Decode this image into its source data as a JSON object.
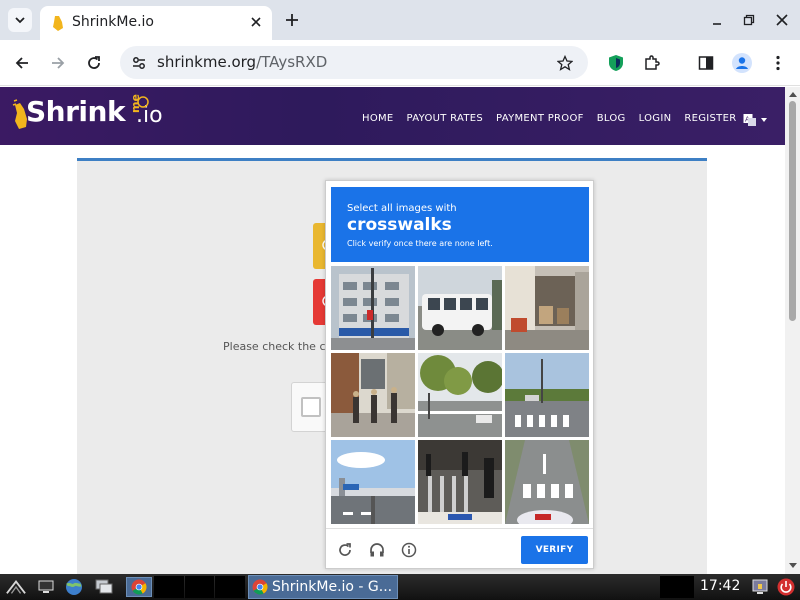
{
  "browser": {
    "tab_title": "ShrinkMe.io",
    "url_domain": "shrinkme.org",
    "url_path": "/TAysRXD"
  },
  "site": {
    "logo_text": "Shrink",
    "logo_me": "me",
    "logo_suffix": ".io",
    "nav": [
      "HOME",
      "PAYOUT RATES",
      "PAYMENT PROOF",
      "BLOG",
      "LOGIN",
      "REGISTER"
    ],
    "check_text": "Please check the ca"
  },
  "captcha": {
    "line1": "Select all images with",
    "target": "crosswalks",
    "line3": "Click verify once there are none left.",
    "verify_label": "VERIFY",
    "tiles": [
      {
        "scene": "building"
      },
      {
        "scene": "bus"
      },
      {
        "scene": "storefront"
      },
      {
        "scene": "pedestrians"
      },
      {
        "scene": "road-trees"
      },
      {
        "scene": "crosswalk"
      },
      {
        "scene": "overpass"
      },
      {
        "scene": "street-crowd"
      },
      {
        "scene": "crosswalk-car"
      }
    ]
  },
  "taskbar": {
    "task_label": "ShrinkMe.io - G...",
    "clock": "17:42"
  },
  "colors": {
    "accent_blue": "#1a73e8",
    "site_header": "#3b1a63",
    "logo_yellow": "#f2b51d"
  }
}
